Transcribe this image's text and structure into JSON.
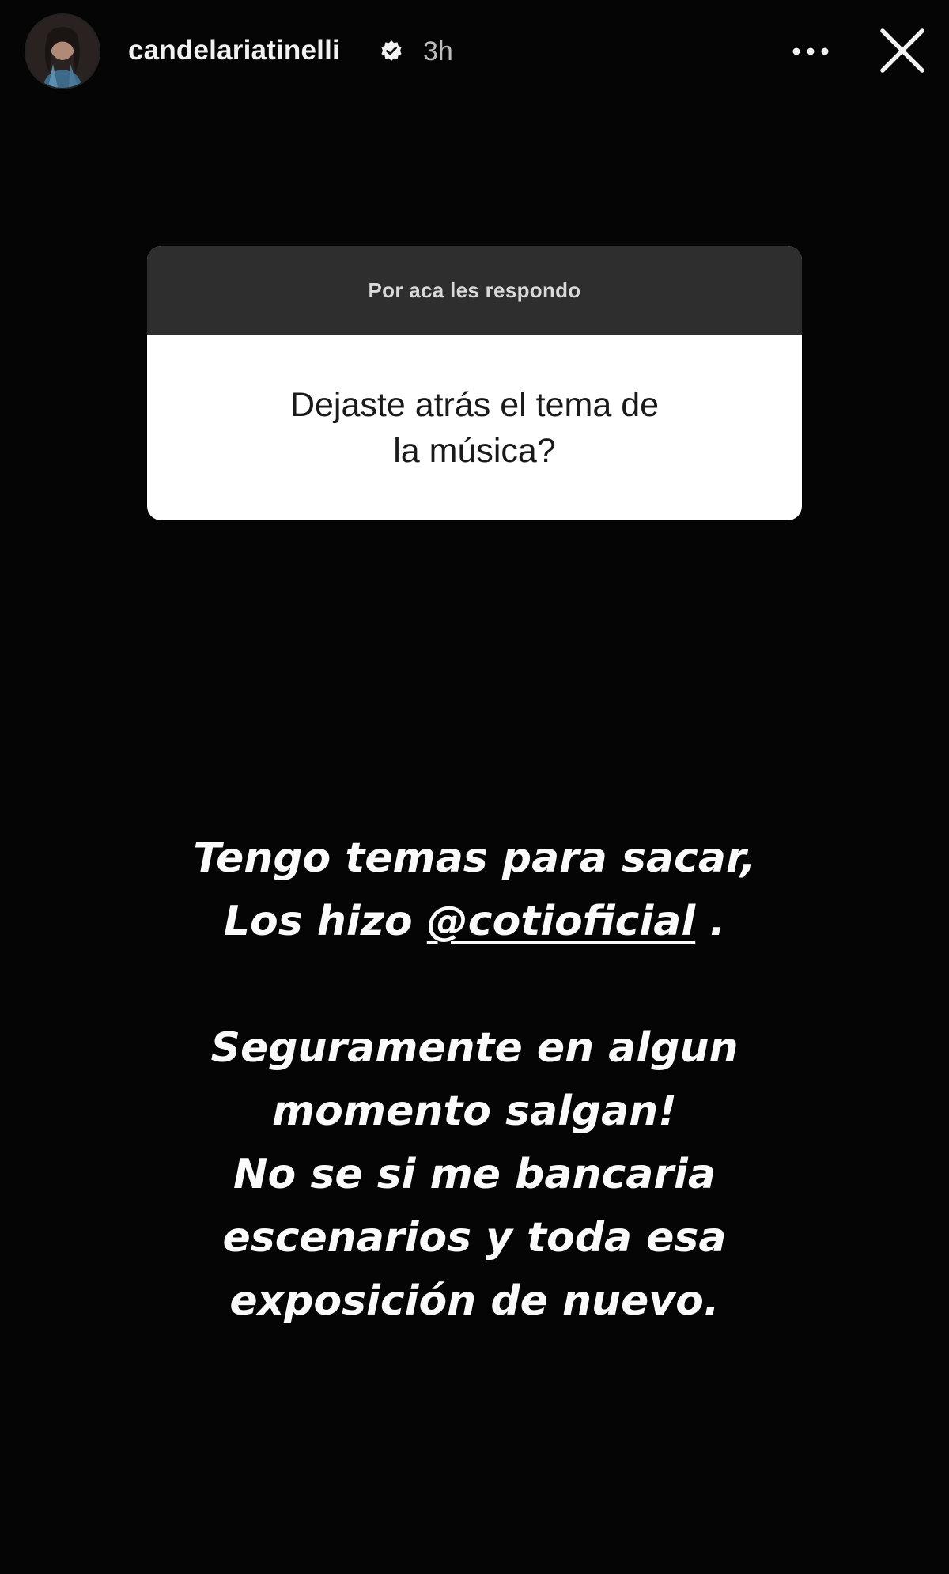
{
  "header": {
    "username": "candelariatinelli",
    "time": "3h"
  },
  "question": {
    "title": "Por aca les respondo",
    "text_line1": "Dejaste atrás el tema de",
    "text_line2": "la música?"
  },
  "answer": {
    "line1": "Tengo temas para sacar,",
    "line2_prefix": "Los hizo ",
    "line2_mention": "@cotioficial",
    "line2_suffix": " .",
    "line3": "Seguramente en algun",
    "line4": "momento salgan!",
    "line5": "No se si me bancaria",
    "line6": "escenarios y toda esa",
    "line7": "exposición de nuevo."
  },
  "colors": {
    "background": "#050505",
    "card_header": "#2e2e2e",
    "card_body": "#ffffff",
    "text": "#fafafa"
  },
  "icons": [
    "avatar",
    "verified-badge-icon",
    "more-options-icon",
    "close-icon"
  ]
}
